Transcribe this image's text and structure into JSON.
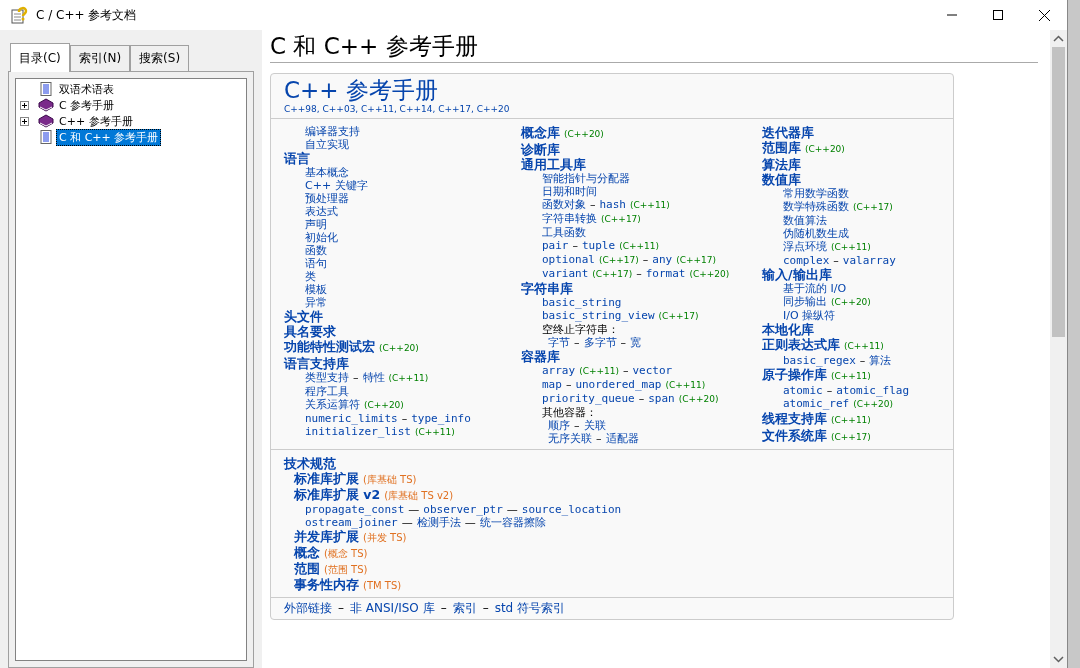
{
  "window": {
    "title": "C / C++ 参考文档"
  },
  "tabs": [
    {
      "label": "目录(C)",
      "selected": true
    },
    {
      "label": "索引(N)",
      "selected": false
    },
    {
      "label": "搜索(S)",
      "selected": false
    }
  ],
  "tree": [
    {
      "label": "双语术语表",
      "kind": "page",
      "selected": false
    },
    {
      "label": "C 参考手册",
      "kind": "book",
      "expanded": false,
      "selected": false
    },
    {
      "label": "C++ 参考手册",
      "kind": "book",
      "expanded": false,
      "selected": false
    },
    {
      "label": "C 和 C++ 参考手册",
      "kind": "page",
      "selected": true
    }
  ],
  "page_title": "C 和 C++ 参考手册",
  "card": {
    "title": "C++ 参考手册",
    "subtitle": "C++98, C++03, C++11, C++14, C++17, C++20",
    "columns": [
      [
        {
          "kind": "item",
          "parts": [
            {
              "kind": "link",
              "text": "编译器支持"
            }
          ]
        },
        {
          "kind": "item",
          "parts": [
            {
              "kind": "link",
              "text": "自立实现"
            }
          ]
        },
        {
          "kind": "heading",
          "parts": [
            {
              "kind": "link",
              "text": "语言"
            }
          ]
        },
        {
          "kind": "item",
          "parts": [
            {
              "kind": "link",
              "text": "基本概念"
            }
          ]
        },
        {
          "kind": "item",
          "parts": [
            {
              "kind": "link",
              "text": "C++ 关键字"
            }
          ]
        },
        {
          "kind": "item",
          "parts": [
            {
              "kind": "link",
              "text": "预处理器"
            }
          ]
        },
        {
          "kind": "item",
          "parts": [
            {
              "kind": "link",
              "text": "表达式"
            }
          ]
        },
        {
          "kind": "item",
          "parts": [
            {
              "kind": "link",
              "text": "声明"
            }
          ]
        },
        {
          "kind": "item",
          "parts": [
            {
              "kind": "link",
              "text": "初始化"
            }
          ]
        },
        {
          "kind": "item",
          "parts": [
            {
              "kind": "link",
              "text": "函数"
            }
          ]
        },
        {
          "kind": "item",
          "parts": [
            {
              "kind": "link",
              "text": "语句"
            }
          ]
        },
        {
          "kind": "item",
          "parts": [
            {
              "kind": "link",
              "text": "类"
            }
          ]
        },
        {
          "kind": "item",
          "parts": [
            {
              "kind": "link",
              "text": "模板"
            }
          ]
        },
        {
          "kind": "item",
          "parts": [
            {
              "kind": "link",
              "text": "异常"
            }
          ]
        },
        {
          "kind": "heading",
          "parts": [
            {
              "kind": "link",
              "text": "头文件"
            }
          ]
        },
        {
          "kind": "heading",
          "parts": [
            {
              "kind": "link",
              "text": "具名要求"
            }
          ]
        },
        {
          "kind": "heading",
          "parts": [
            {
              "kind": "link",
              "text": "功能特性测试宏"
            },
            {
              "kind": "version",
              "text": "(C++20)"
            }
          ]
        },
        {
          "kind": "heading",
          "parts": [
            {
              "kind": "link",
              "text": "语言支持库"
            }
          ]
        },
        {
          "kind": "item",
          "parts": [
            {
              "kind": "link",
              "text": "类型支持"
            },
            {
              "kind": "sep",
              "text": "–"
            },
            {
              "kind": "link",
              "text": "特性"
            },
            {
              "kind": "version",
              "text": "(C++11)"
            }
          ]
        },
        {
          "kind": "item",
          "parts": [
            {
              "kind": "link",
              "text": "程序工具"
            }
          ]
        },
        {
          "kind": "item",
          "parts": [
            {
              "kind": "link",
              "text": "关系运算符"
            },
            {
              "kind": "version",
              "text": "(C++20)"
            }
          ]
        },
        {
          "kind": "item",
          "parts": [
            {
              "kind": "code",
              "text": "numeric_limits"
            },
            {
              "kind": "sep",
              "text": "–"
            },
            {
              "kind": "code",
              "text": "type_info"
            }
          ]
        },
        {
          "kind": "item",
          "parts": [
            {
              "kind": "code",
              "text": "initializer_list"
            },
            {
              "kind": "version",
              "text": "(C++11)"
            }
          ]
        }
      ],
      [
        {
          "kind": "heading",
          "parts": [
            {
              "kind": "link",
              "text": "概念库"
            },
            {
              "kind": "version",
              "text": "(C++20)"
            }
          ]
        },
        {
          "kind": "heading",
          "parts": [
            {
              "kind": "link",
              "text": "诊断库"
            }
          ]
        },
        {
          "kind": "heading",
          "parts": [
            {
              "kind": "link",
              "text": "通用工具库"
            }
          ]
        },
        {
          "kind": "item",
          "parts": [
            {
              "kind": "link",
              "text": "智能指针与分配器"
            }
          ]
        },
        {
          "kind": "item",
          "parts": [
            {
              "kind": "link",
              "text": "日期和时间"
            }
          ]
        },
        {
          "kind": "item",
          "parts": [
            {
              "kind": "link",
              "text": "函数对象"
            },
            {
              "kind": "sep",
              "text": "–"
            },
            {
              "kind": "code",
              "text": "hash"
            },
            {
              "kind": "version",
              "text": "(C++11)"
            }
          ]
        },
        {
          "kind": "item",
          "parts": [
            {
              "kind": "link",
              "text": "字符串转换"
            },
            {
              "kind": "version",
              "text": "(C++17)"
            }
          ]
        },
        {
          "kind": "item",
          "parts": [
            {
              "kind": "link",
              "text": "工具函数"
            }
          ]
        },
        {
          "kind": "item",
          "parts": [
            {
              "kind": "code",
              "text": "pair"
            },
            {
              "kind": "sep",
              "text": "–"
            },
            {
              "kind": "code",
              "text": "tuple"
            },
            {
              "kind": "version",
              "text": "(C++11)"
            }
          ]
        },
        {
          "kind": "item",
          "parts": [
            {
              "kind": "code",
              "text": "optional"
            },
            {
              "kind": "version",
              "text": "(C++17)"
            },
            {
              "kind": "sep",
              "text": "–"
            },
            {
              "kind": "code",
              "text": "any"
            },
            {
              "kind": "version",
              "text": "(C++17)"
            }
          ]
        },
        {
          "kind": "item",
          "parts": [
            {
              "kind": "code",
              "text": "variant"
            },
            {
              "kind": "version",
              "text": "(C++17)"
            },
            {
              "kind": "sep",
              "text": "–"
            },
            {
              "kind": "code",
              "text": "format"
            },
            {
              "kind": "version",
              "text": "(C++20)"
            }
          ]
        },
        {
          "kind": "heading",
          "parts": [
            {
              "kind": "link",
              "text": "字符串库"
            }
          ]
        },
        {
          "kind": "item",
          "parts": [
            {
              "kind": "code",
              "text": "basic_string"
            }
          ]
        },
        {
          "kind": "item",
          "parts": [
            {
              "kind": "code",
              "text": "basic_string_view"
            },
            {
              "kind": "version",
              "text": "(C++17)"
            }
          ]
        },
        {
          "kind": "item",
          "parts": [
            {
              "kind": "plain",
              "text": "空终止字符串："
            }
          ]
        },
        {
          "kind": "subitem",
          "parts": [
            {
              "kind": "link",
              "text": "字节"
            },
            {
              "kind": "sep",
              "text": "–"
            },
            {
              "kind": "link",
              "text": "多字节"
            },
            {
              "kind": "sep",
              "text": "–"
            },
            {
              "kind": "link",
              "text": "宽"
            }
          ]
        },
        {
          "kind": "heading",
          "parts": [
            {
              "kind": "link",
              "text": "容器库"
            }
          ]
        },
        {
          "kind": "item",
          "parts": [
            {
              "kind": "code",
              "text": "array"
            },
            {
              "kind": "version",
              "text": "(C++11)"
            },
            {
              "kind": "sep",
              "text": "–"
            },
            {
              "kind": "code",
              "text": "vector"
            }
          ]
        },
        {
          "kind": "item",
          "parts": [
            {
              "kind": "code",
              "text": "map"
            },
            {
              "kind": "sep",
              "text": "–"
            },
            {
              "kind": "code",
              "text": "unordered_map"
            },
            {
              "kind": "version",
              "text": "(C++11)"
            }
          ]
        },
        {
          "kind": "item",
          "parts": [
            {
              "kind": "code",
              "text": "priority_queue"
            },
            {
              "kind": "sep",
              "text": "–"
            },
            {
              "kind": "code",
              "text": "span"
            },
            {
              "kind": "version",
              "text": "(C++20)"
            }
          ]
        },
        {
          "kind": "item",
          "parts": [
            {
              "kind": "plain",
              "text": "其他容器："
            }
          ]
        },
        {
          "kind": "subitem",
          "parts": [
            {
              "kind": "link",
              "text": "顺序"
            },
            {
              "kind": "sep",
              "text": "–"
            },
            {
              "kind": "link",
              "text": "关联"
            }
          ]
        },
        {
          "kind": "subitem",
          "parts": [
            {
              "kind": "link",
              "text": "无序关联"
            },
            {
              "kind": "sep",
              "text": "–"
            },
            {
              "kind": "link",
              "text": "适配器"
            }
          ]
        }
      ],
      [
        {
          "kind": "heading",
          "parts": [
            {
              "kind": "link",
              "text": "迭代器库"
            }
          ]
        },
        {
          "kind": "heading",
          "parts": [
            {
              "kind": "link",
              "text": "范围库"
            },
            {
              "kind": "version",
              "text": "(C++20)"
            }
          ]
        },
        {
          "kind": "heading",
          "parts": [
            {
              "kind": "link",
              "text": "算法库"
            }
          ]
        },
        {
          "kind": "heading",
          "parts": [
            {
              "kind": "link",
              "text": "数值库"
            }
          ]
        },
        {
          "kind": "item",
          "parts": [
            {
              "kind": "link",
              "text": "常用数学函数"
            }
          ]
        },
        {
          "kind": "item",
          "parts": [
            {
              "kind": "link",
              "text": "数学特殊函数"
            },
            {
              "kind": "version",
              "text": "(C++17)"
            }
          ]
        },
        {
          "kind": "item",
          "parts": [
            {
              "kind": "link",
              "text": "数值算法"
            }
          ]
        },
        {
          "kind": "item",
          "parts": [
            {
              "kind": "link",
              "text": "伪随机数生成"
            }
          ]
        },
        {
          "kind": "item",
          "parts": [
            {
              "kind": "link",
              "text": "浮点环境"
            },
            {
              "kind": "version",
              "text": "(C++11)"
            }
          ]
        },
        {
          "kind": "item",
          "parts": [
            {
              "kind": "code",
              "text": "complex"
            },
            {
              "kind": "sep",
              "text": "–"
            },
            {
              "kind": "code",
              "text": "valarray"
            }
          ]
        },
        {
          "kind": "heading",
          "parts": [
            {
              "kind": "link",
              "text": "输入/输出库"
            }
          ]
        },
        {
          "kind": "item",
          "parts": [
            {
              "kind": "link",
              "text": "基于流的 I/O"
            }
          ]
        },
        {
          "kind": "item",
          "parts": [
            {
              "kind": "link",
              "text": "同步输出"
            },
            {
              "kind": "version",
              "text": "(C++20)"
            }
          ]
        },
        {
          "kind": "item",
          "parts": [
            {
              "kind": "link",
              "text": "I/O 操纵符"
            }
          ]
        },
        {
          "kind": "heading",
          "parts": [
            {
              "kind": "link",
              "text": "本地化库"
            }
          ]
        },
        {
          "kind": "heading",
          "parts": [
            {
              "kind": "link",
              "text": "正则表达式库"
            },
            {
              "kind": "version",
              "text": "(C++11)"
            }
          ]
        },
        {
          "kind": "item",
          "parts": [
            {
              "kind": "code",
              "text": "basic_regex"
            },
            {
              "kind": "sep",
              "text": "–"
            },
            {
              "kind": "link",
              "text": "算法"
            }
          ]
        },
        {
          "kind": "heading",
          "parts": [
            {
              "kind": "link",
              "text": "原子操作库"
            },
            {
              "kind": "version",
              "text": "(C++11)"
            }
          ]
        },
        {
          "kind": "item",
          "parts": [
            {
              "kind": "code",
              "text": "atomic"
            },
            {
              "kind": "sep",
              "text": "–"
            },
            {
              "kind": "code",
              "text": "atomic_flag"
            }
          ]
        },
        {
          "kind": "item",
          "parts": [
            {
              "kind": "code",
              "text": "atomic_ref"
            },
            {
              "kind": "version",
              "text": "(C++20)"
            }
          ]
        },
        {
          "kind": "heading",
          "parts": [
            {
              "kind": "link",
              "text": "线程支持库"
            },
            {
              "kind": "version",
              "text": "(C++11)"
            }
          ]
        },
        {
          "kind": "heading",
          "parts": [
            {
              "kind": "link",
              "text": "文件系统库"
            },
            {
              "kind": "version",
              "text": "(C++17)"
            }
          ]
        }
      ]
    ],
    "specs": [
      {
        "kind": "heading",
        "parts": [
          {
            "kind": "link",
            "text": "技术规范"
          }
        ]
      },
      {
        "kind": "subheading",
        "parts": [
          {
            "kind": "link",
            "text": "标准库扩展"
          },
          {
            "kind": "ts",
            "text": "(库基础 TS)"
          }
        ]
      },
      {
        "kind": "subheading",
        "parts": [
          {
            "kind": "link",
            "text": "标准库扩展 v2"
          },
          {
            "kind": "ts",
            "text": "(库基础 TS v2)"
          }
        ]
      },
      {
        "kind": "item",
        "parts": [
          {
            "kind": "code",
            "text": "propagate_const"
          },
          {
            "kind": "sep",
            "text": "—"
          },
          {
            "kind": "code",
            "text": "observer_ptr"
          },
          {
            "kind": "sep",
            "text": "—"
          },
          {
            "kind": "code",
            "text": "source_location"
          }
        ]
      },
      {
        "kind": "item",
        "parts": [
          {
            "kind": "code",
            "text": "ostream_joiner"
          },
          {
            "kind": "sep",
            "text": "—"
          },
          {
            "kind": "link",
            "text": "检测手法"
          },
          {
            "kind": "sep",
            "text": "—"
          },
          {
            "kind": "link",
            "text": "统一容器擦除"
          }
        ]
      },
      {
        "kind": "subheading",
        "parts": [
          {
            "kind": "link",
            "text": "并发库扩展"
          },
          {
            "kind": "ts",
            "text": "(并发 TS)"
          }
        ]
      },
      {
        "kind": "subheading",
        "parts": [
          {
            "kind": "link",
            "text": "概念"
          },
          {
            "kind": "ts",
            "text": "(概念 TS)"
          }
        ]
      },
      {
        "kind": "subheading",
        "parts": [
          {
            "kind": "link",
            "text": "范围"
          },
          {
            "kind": "ts",
            "text": "(范围 TS)"
          }
        ]
      },
      {
        "kind": "subheading",
        "parts": [
          {
            "kind": "link",
            "text": "事务性内存"
          },
          {
            "kind": "ts",
            "text": "(TM TS)"
          }
        ]
      }
    ],
    "footer": [
      {
        "kind": "footer-link",
        "text": "外部链接"
      },
      {
        "kind": "sep",
        "text": "–"
      },
      {
        "kind": "footer-link",
        "text": "非 ANSI/ISO 库"
      },
      {
        "kind": "sep",
        "text": "–"
      },
      {
        "kind": "footer-link",
        "text": "索引"
      },
      {
        "kind": "sep",
        "text": "–"
      },
      {
        "kind": "footer-link",
        "text": "std 符号索引"
      }
    ]
  }
}
